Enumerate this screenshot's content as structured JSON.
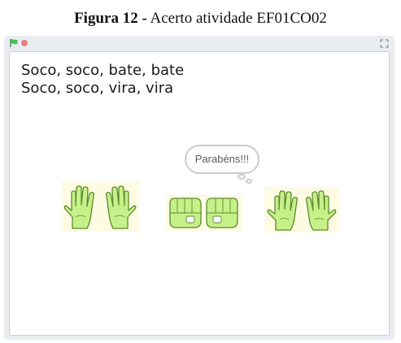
{
  "caption": {
    "label": "Figura 12 -",
    "text": " Acerto atividade EF01CO02"
  },
  "player": {
    "controls": {
      "green_flag_icon": "green-flag-icon",
      "stop_icon": "stop-icon",
      "fullscreen_icon": "fullscreen-icon"
    },
    "stage": {
      "lyrics": [
        "Soco, soco, bate, bate",
        "Soco, soco, vira, vira"
      ],
      "speech_bubble": "Parabéns!!!",
      "sprites": [
        "open-hands-palm-sprite",
        "fists-sprite",
        "open-hands-back-sprite"
      ]
    }
  },
  "colors": {
    "hand_fill": "#c6f08a",
    "hand_stroke": "#5c8a2e",
    "sprite_bg": "#fefbe3",
    "flag": "#4cbf56",
    "stop": "#ec5959"
  }
}
